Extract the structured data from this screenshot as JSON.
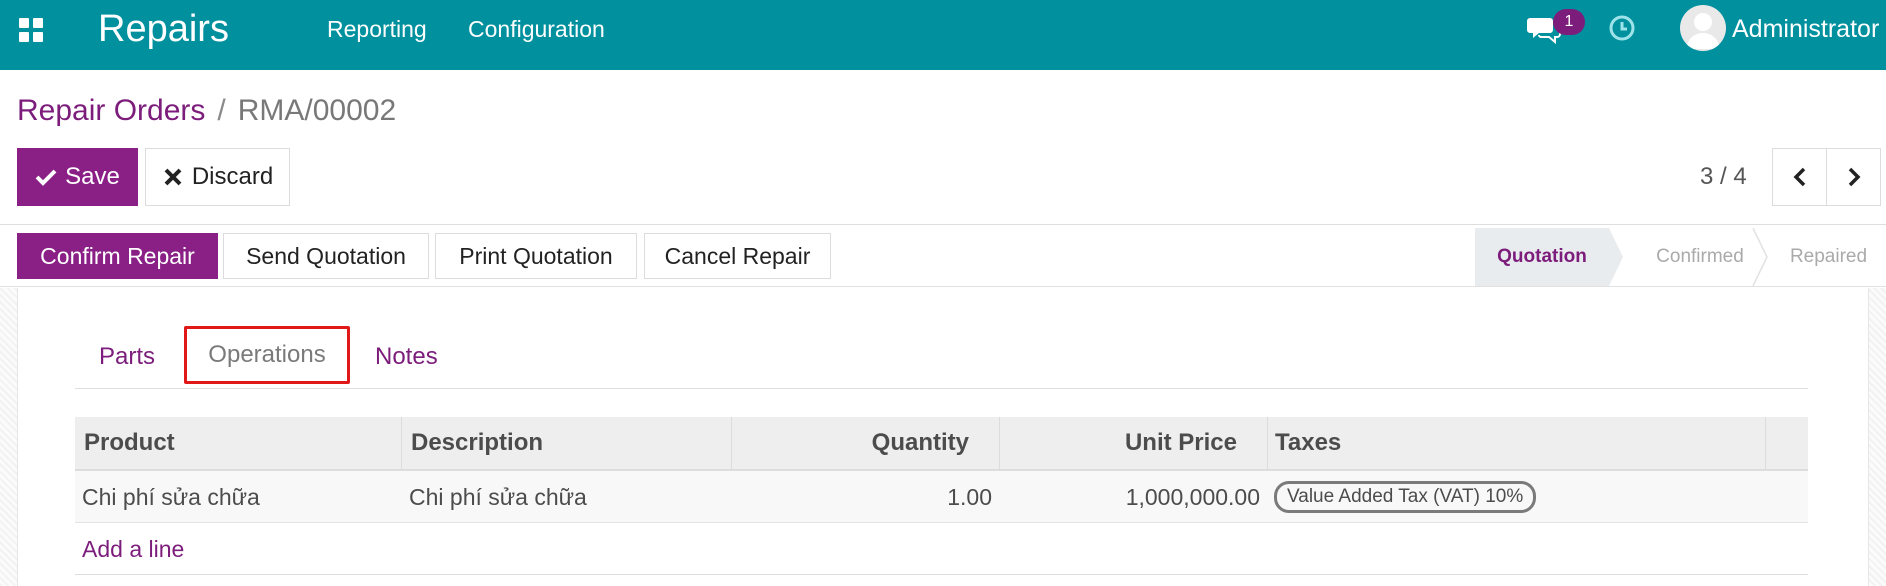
{
  "navbar": {
    "app_name": "Repairs",
    "menu": {
      "reporting": "Reporting",
      "configuration": "Configuration"
    },
    "chat_badge_count": "1",
    "user_name": "Administrator",
    "color": "#00909e"
  },
  "breadcrumb": {
    "parent": "Repair Orders",
    "separator": "/",
    "current": "RMA/00002"
  },
  "controls": {
    "save_label": "Save",
    "discard_label": "Discard"
  },
  "pager": {
    "value": "3 / 4"
  },
  "actions": {
    "confirm_repair": "Confirm Repair",
    "send_quotation": "Send Quotation",
    "print_quotation": "Print Quotation",
    "cancel_repair": "Cancel Repair"
  },
  "stages": {
    "quotation": "Quotation",
    "confirmed": "Confirmed",
    "repaired": "Repaired",
    "active": "Quotation"
  },
  "tabs": {
    "parts": "Parts",
    "operations": "Operations",
    "notes": "Notes"
  },
  "table": {
    "headers": {
      "product": "Product",
      "description": "Description",
      "quantity": "Quantity",
      "unit_price": "Unit Price",
      "taxes": "Taxes"
    },
    "rows": [
      {
        "product": "Chi phí sửa chữa",
        "description": "Chi phí sửa chữa",
        "quantity": "1.00",
        "unit_price": "1,000,000.00",
        "taxes": "Value Added Tax (VAT) 10%"
      }
    ],
    "add_line": "Add a line"
  },
  "icons": {
    "apps": "apps-grid-icon",
    "chat": "chat-icon",
    "clock": "clock-icon",
    "avatar": "user-avatar-icon",
    "save": "check-icon",
    "discard": "x-icon",
    "prev": "chevron-left-icon",
    "next": "chevron-right-icon"
  },
  "colors": {
    "primary": "#8a1f86",
    "link": "#7c1d7c",
    "highlight_border": "#e01818"
  }
}
